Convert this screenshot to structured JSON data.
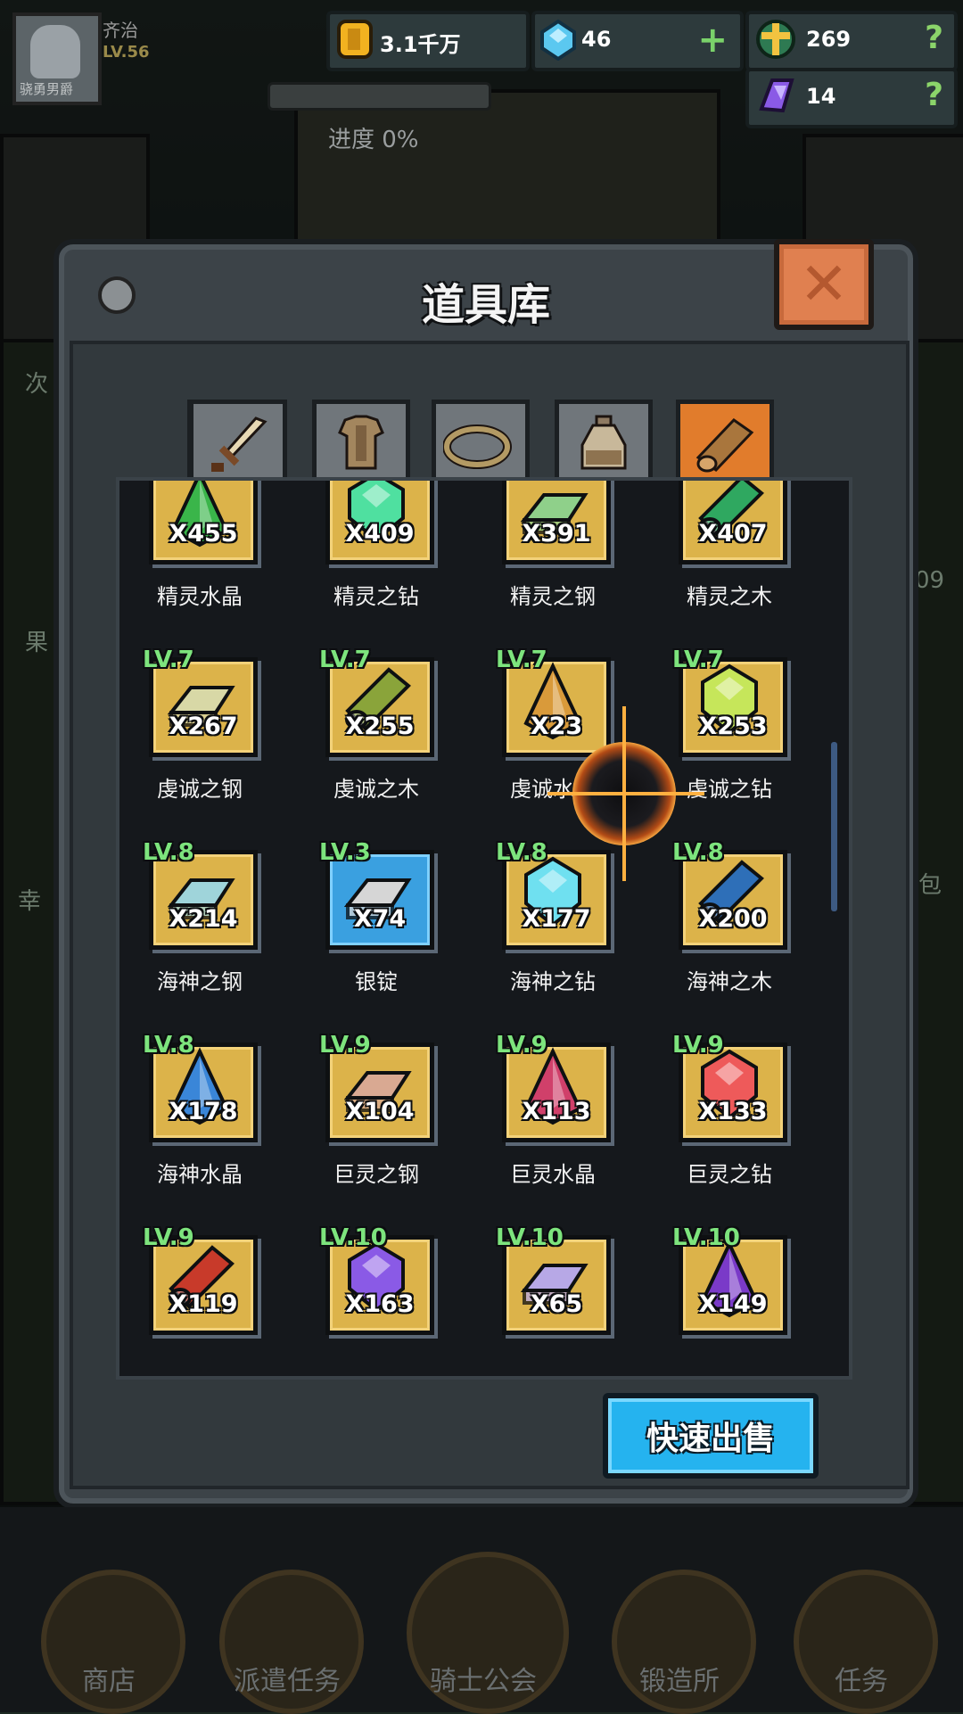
{
  "player": {
    "name": "齐治",
    "level": "LV.56",
    "avatar_tag": "骁勇男爵"
  },
  "hud": {
    "gold": "3.1千万",
    "gems": "46",
    "gems_add": "+",
    "crosses": "269",
    "crosses_help": "?",
    "crystals": "14",
    "crystals_help": "?",
    "progress": "进度 0%"
  },
  "panel": {
    "title": "道具库",
    "tabs": [
      "sword",
      "armor",
      "ring",
      "potion",
      "material"
    ],
    "active_tab": "material",
    "sell_button": "快速出售"
  },
  "items": [
    {
      "lv": "",
      "count": "X455",
      "name": "精灵水晶",
      "color": "#3ab54a",
      "shape": "crystal"
    },
    {
      "lv": "",
      "count": "X409",
      "name": "精灵之钻",
      "color": "#4fe0a0",
      "shape": "gem"
    },
    {
      "lv": "",
      "count": "X391",
      "name": "精灵之钢",
      "color": "#8fd08a",
      "shape": "ingot"
    },
    {
      "lv": "",
      "count": "X407",
      "name": "精灵之木",
      "color": "#2fa860",
      "shape": "log"
    },
    {
      "lv": "LV.7",
      "count": "X267",
      "name": "虔诚之钢",
      "color": "#d8d8a6",
      "shape": "ingot"
    },
    {
      "lv": "LV.7",
      "count": "X255",
      "name": "虔诚之木",
      "color": "#8aa43a",
      "shape": "log"
    },
    {
      "lv": "LV.7",
      "count": "X23",
      "name": "虔诚水晶",
      "color": "#d99a3a",
      "shape": "crystal"
    },
    {
      "lv": "LV.7",
      "count": "X253",
      "name": "虔诚之钻",
      "color": "#c6e65a",
      "shape": "gem"
    },
    {
      "lv": "LV.8",
      "count": "X214",
      "name": "海神之钢",
      "color": "#9fd4da",
      "shape": "ingot"
    },
    {
      "lv": "LV.3",
      "count": "X74",
      "name": "银锭",
      "color": "#d6d6d6",
      "shape": "ingot",
      "blue": true
    },
    {
      "lv": "LV.8",
      "count": "X177",
      "name": "海神之钻",
      "color": "#6fe0f0",
      "shape": "gem"
    },
    {
      "lv": "LV.8",
      "count": "X200",
      "name": "海神之木",
      "color": "#2e6fb8",
      "shape": "log"
    },
    {
      "lv": "LV.8",
      "count": "X178",
      "name": "海神水晶",
      "color": "#3a86d8",
      "shape": "crystal"
    },
    {
      "lv": "LV.9",
      "count": "X104",
      "name": "巨灵之钢",
      "color": "#d9a992",
      "shape": "ingot"
    },
    {
      "lv": "LV.9",
      "count": "X113",
      "name": "巨灵水晶",
      "color": "#d0406a",
      "shape": "crystal"
    },
    {
      "lv": "LV.9",
      "count": "X133",
      "name": "巨灵之钻",
      "color": "#ee5a5a",
      "shape": "gem"
    },
    {
      "lv": "LV.9",
      "count": "X119",
      "name": "",
      "color": "#c83a2a",
      "shape": "log"
    },
    {
      "lv": "LV.10",
      "count": "X163",
      "name": "",
      "color": "#8a5ae6",
      "shape": "gem"
    },
    {
      "lv": "LV.10",
      "count": "X65",
      "name": "",
      "color": "#b7a8e6",
      "shape": "ingot"
    },
    {
      "lv": "LV.10",
      "count": "X149",
      "name": "",
      "color": "#7a3ac8",
      "shape": "crystal"
    }
  ],
  "bottom_nav": [
    "商店",
    "派遣任务",
    "骑士公会",
    "锻造所",
    "任务"
  ],
  "side_texts": [
    "次",
    "果",
    "幸",
    "包",
    "09"
  ]
}
